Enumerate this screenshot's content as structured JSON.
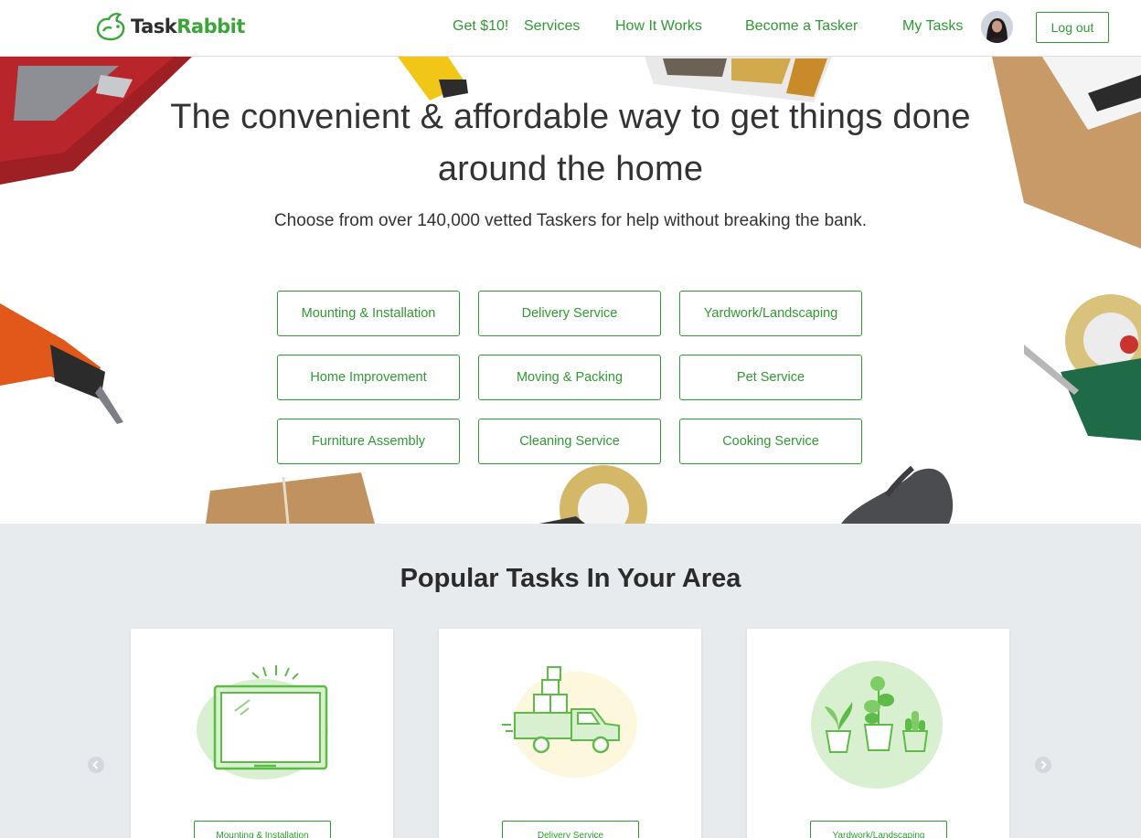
{
  "header": {
    "logo_part1": "Task",
    "logo_part2": "Rabbit",
    "nav": {
      "promo": "Get $10!",
      "services": "Services",
      "how": "How It Works",
      "become": "Become a Tasker",
      "mytasks": "My Tasks"
    },
    "logout": "Log out"
  },
  "hero": {
    "title_line1": "The convenient & affordable way to get things done",
    "title_line2": "around the home",
    "subtitle": "Choose from over 140,000 vetted Taskers for help without breaking the bank.",
    "categories": [
      "Mounting & Installation",
      "Delivery Service",
      "Yardwork/Landscaping",
      "Home Improvement",
      "Moving & Packing",
      "Pet Service",
      "Furniture Assembly",
      "Cleaning Service",
      "Cooking Service"
    ]
  },
  "popular": {
    "title": "Popular Tasks In Your Area",
    "cards": [
      {
        "button": "Mounting & Installation",
        "icon": "tv-icon"
      },
      {
        "button": "Delivery Service",
        "icon": "truck-icon"
      },
      {
        "button": "Yardwork/Landscaping",
        "icon": "plants-icon"
      }
    ]
  },
  "colors": {
    "brand_green": "#2f9a31",
    "popular_bg": "#e8ebee"
  }
}
